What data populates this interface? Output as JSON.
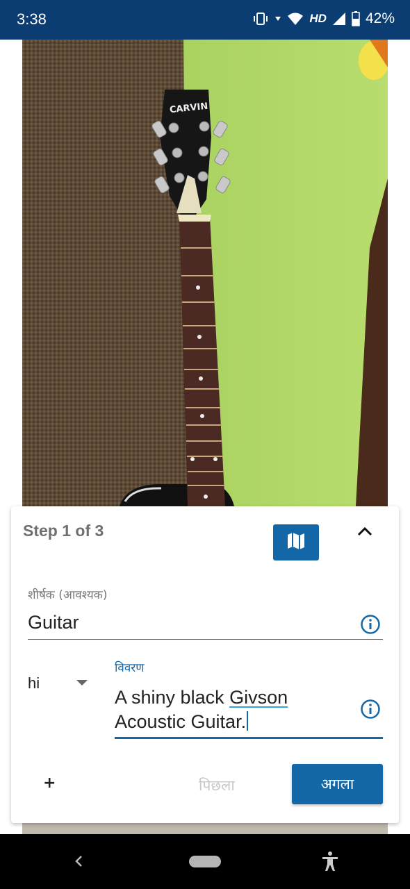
{
  "status": {
    "time": "3:38",
    "network": "HD",
    "battery": "42%"
  },
  "card": {
    "step": "Step 1 of 3",
    "title_label": "शीर्षक (आवश्यक)",
    "title_value": "Guitar",
    "language": "hi",
    "description_label": "विवरण",
    "description_part1": "A shiny black ",
    "description_misspelled": "Givson",
    "description_part2": "Acoustic Guitar.",
    "add_label": "+",
    "previous_label": "पिछला",
    "next_label": "अगला"
  },
  "photo": {
    "headstock_brand": "CARVIN"
  },
  "colors": {
    "status_bar": "#0b3d73",
    "primary": "#1467a6"
  }
}
